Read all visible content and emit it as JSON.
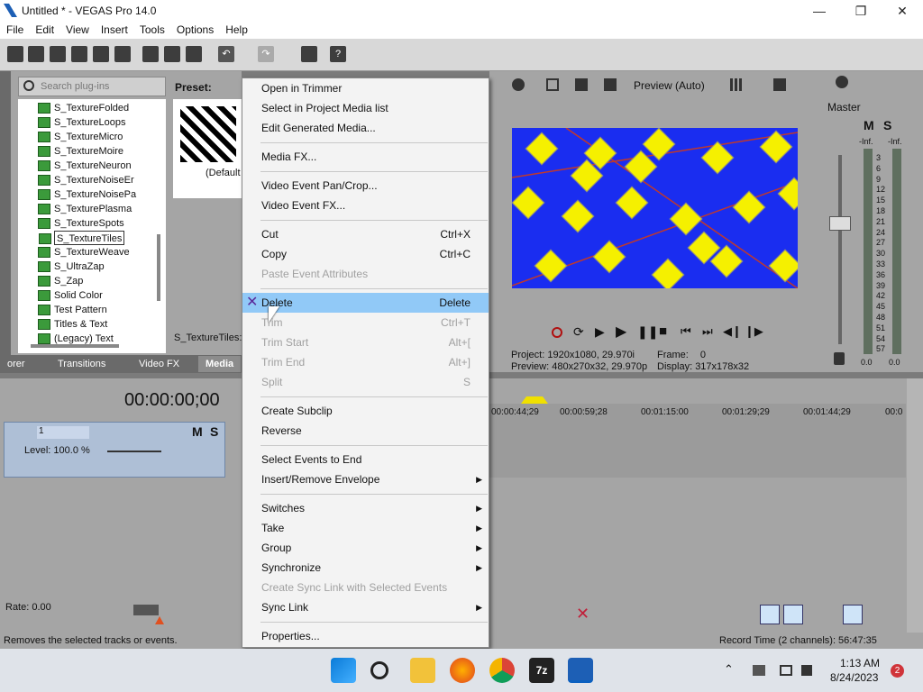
{
  "window": {
    "title": "Untitled * - VEGAS Pro 14.0",
    "minimize": "—",
    "maximize": "❐",
    "close": "✕"
  },
  "menu": [
    "File",
    "Edit",
    "View",
    "Insert",
    "Tools",
    "Options",
    "Help"
  ],
  "plugins": {
    "search_placeholder": "Search plug-ins",
    "items": [
      "S_TextureFolded",
      "S_TextureLoops",
      "S_TextureMicro",
      "S_TextureMoire",
      "S_TextureNeuron",
      "S_TextureNoiseEr",
      "S_TextureNoisePa",
      "S_TexturePlasma",
      "S_TextureSpots",
      "S_TextureTiles",
      "S_TextureWeave",
      "S_UltraZap",
      "S_Zap",
      "Solid Color",
      "Test Pattern",
      "Titles & Text",
      "(Legacy) Text"
    ],
    "selected": "S_TextureTiles"
  },
  "preset": {
    "label": "Preset:",
    "thumb_caption": "(Default",
    "footer": "S_TextureTiles:"
  },
  "tabs": [
    "orer",
    "Transitions",
    "Video FX",
    "Media"
  ],
  "preview": {
    "mode": "Preview (Auto)",
    "project_label": "Project:",
    "project_value": "1920x1080, 29.970i",
    "frame_label": "Frame:",
    "frame_value": "0",
    "preview_label": "Preview:",
    "preview_value": "480x270x32, 29.970p",
    "display_label": "Display:",
    "display_value": "317x178x32"
  },
  "master": {
    "label": "Master",
    "m": "M",
    "s": "S",
    "inf_left": "-Inf.",
    "inf_right": "-Inf.",
    "left_value": "0.0",
    "right_value": "0.0",
    "scale": [
      "3",
      "6",
      "9",
      "12",
      "15",
      "18",
      "21",
      "24",
      "27",
      "30",
      "33",
      "36",
      "39",
      "42",
      "45",
      "48",
      "51",
      "54",
      "57"
    ]
  },
  "timeline": {
    "timecode": "00:00:00;00",
    "ruler": [
      "00:00:44;29",
      "00:00:59;28",
      "00:01:15:00",
      "00:01:29;29",
      "00:01:44;29",
      "00:0"
    ],
    "track_num": "1",
    "level": "Level: 100.0 %",
    "m": "M",
    "s": "S",
    "rate": "Rate: 0.00"
  },
  "status": {
    "left": "Removes the selected tracks or events.",
    "right": "Record Time (2 channels): 56:47:35"
  },
  "context_menu": [
    {
      "label": "Open in Trimmer",
      "state": "normal"
    },
    {
      "label": "Select in Project Media list",
      "state": "normal"
    },
    {
      "label": "Edit Generated Media...",
      "state": "normal"
    },
    {
      "sep": true
    },
    {
      "label": "Media FX...",
      "state": "normal"
    },
    {
      "sep": true
    },
    {
      "label": "Video Event Pan/Crop...",
      "state": "normal"
    },
    {
      "label": "Video Event FX...",
      "state": "normal"
    },
    {
      "sep": true
    },
    {
      "label": "Cut",
      "shortcut": "Ctrl+X",
      "state": "normal"
    },
    {
      "label": "Copy",
      "shortcut": "Ctrl+C",
      "state": "normal"
    },
    {
      "label": "Paste Event Attributes",
      "state": "disabled"
    },
    {
      "sep": true
    },
    {
      "label": "Delete",
      "shortcut": "Delete",
      "state": "highlighted"
    },
    {
      "label": "Trim",
      "shortcut": "Ctrl+T",
      "state": "disabled"
    },
    {
      "label": "Trim Start",
      "shortcut": "Alt+[",
      "state": "disabled"
    },
    {
      "label": "Trim End",
      "shortcut": "Alt+]",
      "state": "disabled"
    },
    {
      "label": "Split",
      "shortcut": "S",
      "state": "disabled"
    },
    {
      "sep": true
    },
    {
      "label": "Create Subclip",
      "state": "normal"
    },
    {
      "label": "Reverse",
      "state": "normal"
    },
    {
      "sep": true
    },
    {
      "label": "Select Events to End",
      "state": "normal"
    },
    {
      "label": "Insert/Remove Envelope",
      "submenu": true,
      "state": "normal"
    },
    {
      "sep": true
    },
    {
      "label": "Switches",
      "submenu": true,
      "state": "normal"
    },
    {
      "label": "Take",
      "submenu": true,
      "state": "normal"
    },
    {
      "label": "Group",
      "submenu": true,
      "state": "normal"
    },
    {
      "label": "Synchronize",
      "submenu": true,
      "state": "normal"
    },
    {
      "label": "Create Sync Link with Selected Events",
      "state": "disabled"
    },
    {
      "label": "Sync Link",
      "submenu": true,
      "state": "normal"
    },
    {
      "sep": true
    },
    {
      "label": "Properties...",
      "state": "normal"
    }
  ],
  "taskbar": {
    "time": "1:13 AM",
    "date": "8/24/2023",
    "badge": "2",
    "apps": [
      "windows-start",
      "search",
      "file-explorer",
      "firefox",
      "chrome",
      "7zip",
      "vegas"
    ]
  },
  "colors": {
    "accent": "#91c9f7",
    "preview_bg": "#1a2df0",
    "tile": "#f5f000",
    "track": "#aebfd6"
  }
}
